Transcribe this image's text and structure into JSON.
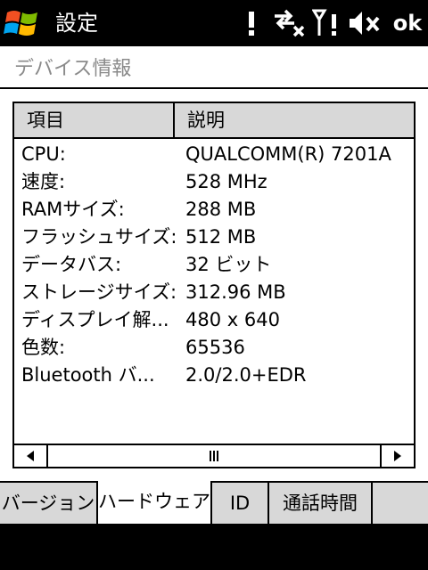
{
  "titlebar": {
    "title": "設定",
    "ok_label": "ok",
    "icons": [
      "windows-start-icon",
      "notification-exclamation-icon",
      "data-connection-off-icon",
      "signal-icon",
      "speaker-muted-icon"
    ]
  },
  "page": {
    "title": "デバイス情報"
  },
  "list": {
    "columns": [
      "項目",
      "説明"
    ],
    "rows": [
      {
        "item": "CPU:",
        "desc": "QUALCOMM(R) 7201A"
      },
      {
        "item": "速度:",
        "desc": "528 MHz"
      },
      {
        "item": "RAMサイズ:",
        "desc": "288 MB"
      },
      {
        "item": "フラッシュサイズ:",
        "desc": "512 MB"
      },
      {
        "item": "データバス:",
        "desc": "32 ビット"
      },
      {
        "item": "ストレージサイズ:",
        "desc": "312.96 MB"
      },
      {
        "item": "ディスプレイ解...",
        "desc": "480 x 640"
      },
      {
        "item": "色数:",
        "desc": "65536"
      },
      {
        "item": "Bluetooth バ...",
        "desc": "2.0/2.0+EDR"
      }
    ]
  },
  "tabs": [
    {
      "label": "バージョン",
      "active": false
    },
    {
      "label": "ハードウェア",
      "active": true
    },
    {
      "label": "ID",
      "active": false
    },
    {
      "label": "通話時間",
      "active": false
    }
  ],
  "colors": {
    "titlebar_bg": "#000000",
    "heading_text": "#8a8a8a",
    "header_bg": "#d8d8d8",
    "tab_bg": "#d8d8d8"
  }
}
